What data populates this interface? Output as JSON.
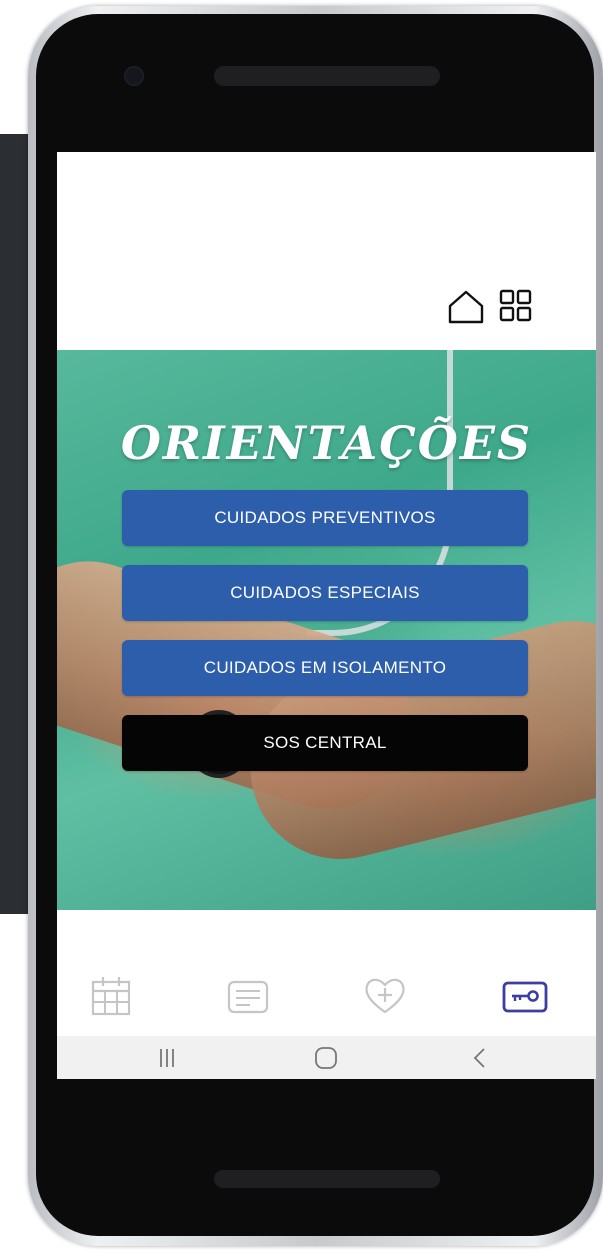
{
  "hero": {
    "title": "ORIENTAÇÕES"
  },
  "menu": {
    "buttons": [
      {
        "label": "CUIDADOS PREVENTIVOS"
      },
      {
        "label": "CUIDADOS ESPECIAIS"
      },
      {
        "label": "CUIDADOS EM ISOLAMENTO"
      },
      {
        "label": "SOS CENTRAL"
      }
    ]
  },
  "header": {
    "icons": [
      "home-icon",
      "grid-icon"
    ]
  },
  "bottom_nav": {
    "items": [
      {
        "icon": "calendar-icon",
        "active": false
      },
      {
        "icon": "document-icon",
        "active": false
      },
      {
        "icon": "heart-plus-icon",
        "active": false
      },
      {
        "icon": "key-icon",
        "active": true
      }
    ]
  },
  "system_nav": {
    "icons": [
      "recent-apps-icon",
      "home-circle-icon",
      "back-icon"
    ]
  },
  "colors": {
    "primary_button": "#2d5eac",
    "sos_button": "#050505",
    "active_nav": "#3d3fa0",
    "inactive_nav": "#c5c5c5",
    "hero_scrub": "#4fb497"
  }
}
